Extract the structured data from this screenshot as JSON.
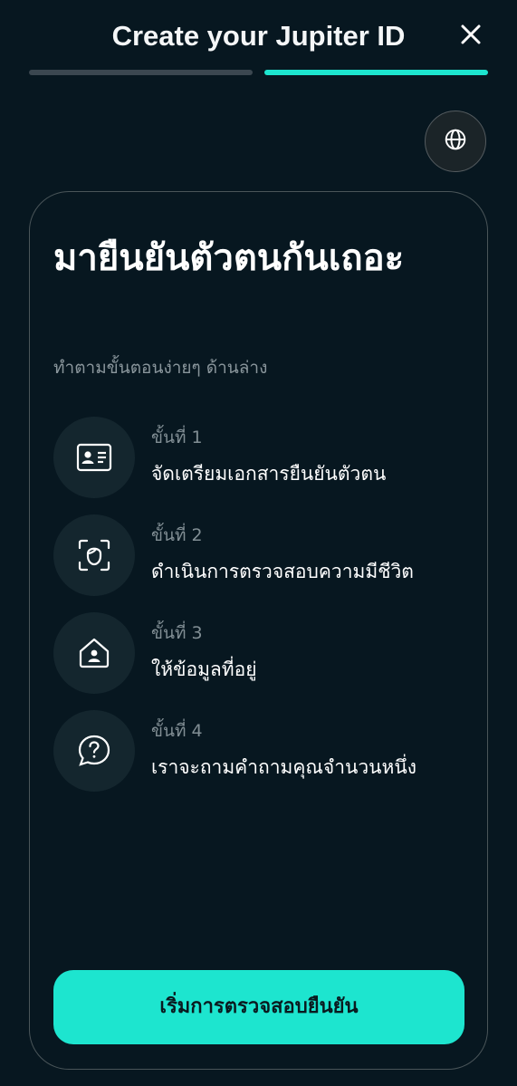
{
  "header": {
    "title": "Create your Jupiter ID",
    "close_icon": "close-icon",
    "progress_steps": 2,
    "progress_current": 2
  },
  "language_button": {
    "icon": "globe-icon"
  },
  "card": {
    "title": "มายืนยันตัวตนกันเถอะ",
    "subtitle": "ทำตามขั้นตอนง่ายๆ ด้านล่าง",
    "steps": [
      {
        "label": "ขั้นที่ 1",
        "text": "จัดเตรียมเอกสารยืนยันตัวตน",
        "icon": "id-card-icon"
      },
      {
        "label": "ขั้นที่ 2",
        "text": "ดำเนินการตรวจสอบความมีชีวิต",
        "icon": "face-scan-icon"
      },
      {
        "label": "ขั้นที่ 3",
        "text": "ให้ข้อมูลที่อยู่",
        "icon": "home-person-icon"
      },
      {
        "label": "ขั้นที่ 4",
        "text": "เราจะถามคำถามคุณจำนวนหนึ่ง",
        "icon": "question-icon"
      }
    ],
    "cta_label": "เริ่มการตรวจสอบยืนยัน"
  },
  "colors": {
    "background": "#071720",
    "accent": "#1de5cf",
    "muted_text": "#818e94",
    "progress_inactive": "#3b4750"
  }
}
